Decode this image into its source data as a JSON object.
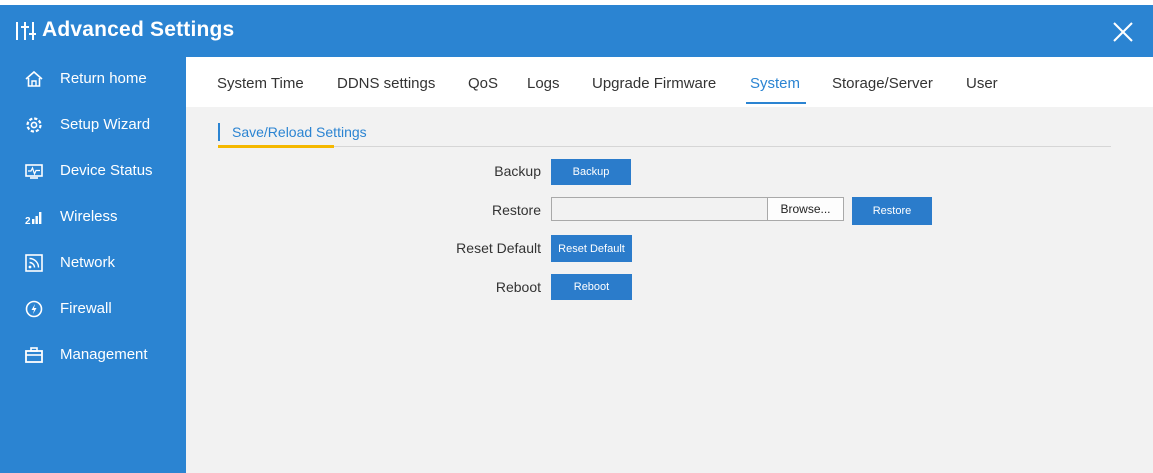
{
  "window": {
    "title": "Advanced Settings",
    "accent_color": "#2b84d2",
    "close_icon": "close-icon"
  },
  "sidebar": {
    "items": [
      {
        "label": "Return home",
        "icon": "home-icon"
      },
      {
        "label": "Setup Wizard",
        "icon": "wizard-icon"
      },
      {
        "label": "Device Status",
        "icon": "status-monitor-icon"
      },
      {
        "label": "Wireless",
        "icon": "signal-icon"
      },
      {
        "label": "Network",
        "icon": "network-icon"
      },
      {
        "label": "Firewall",
        "icon": "shield-icon"
      },
      {
        "label": "Management",
        "icon": "toolbox-icon"
      }
    ]
  },
  "tabs": [
    {
      "label": "System Time"
    },
    {
      "label": "DDNS settings"
    },
    {
      "label": "QoS"
    },
    {
      "label": "Logs"
    },
    {
      "label": "Upgrade Firmware"
    },
    {
      "label": "System",
      "active": true
    },
    {
      "label": "Storage/Server"
    },
    {
      "label": "User"
    }
  ],
  "section": {
    "title": "Save/Reload Settings",
    "accent_color": "#f5b800"
  },
  "form": {
    "backup_label": "Backup",
    "backup_button": "Backup",
    "restore_label": "Restore",
    "restore_file_value": "",
    "browse_button": "Browse...",
    "restore_button": "Restore",
    "reset_label": "Reset Default",
    "reset_button": "Reset Default",
    "reboot_label": "Reboot",
    "reboot_button": "Reboot"
  }
}
